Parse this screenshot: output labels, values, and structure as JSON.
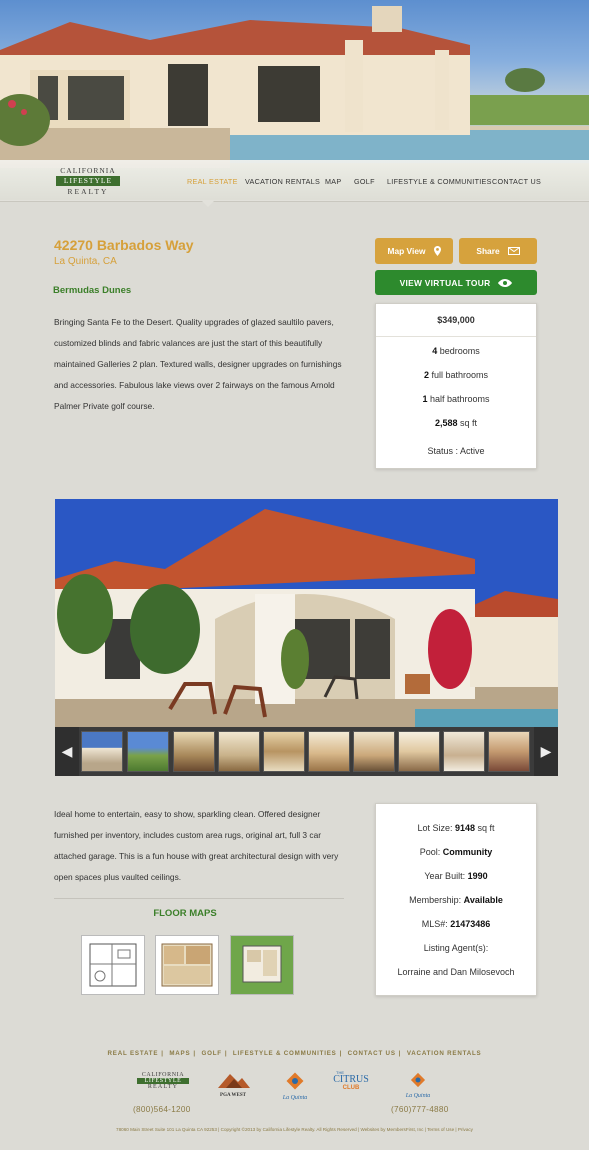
{
  "logo": {
    "line1": "CALIFORNIA",
    "line2": "LIFESTYLE",
    "line3": "REALTY"
  },
  "nav": [
    {
      "label": "REAL ESTATE",
      "active": true
    },
    {
      "label": "VACATION RENTALS",
      "active": false
    },
    {
      "label": "MAP",
      "active": false
    },
    {
      "label": "GOLF",
      "active": false
    },
    {
      "label": "LIFESTYLE & COMMUNITIES",
      "active": false
    },
    {
      "label": "CONTACT US",
      "active": false
    }
  ],
  "listing": {
    "address": "42270 Barbados Way",
    "city": "La Quinta, CA",
    "subdivision": "Bermudas Dunes",
    "description": "Bringing Santa Fe to the Desert. Quality upgrades of glazed saultilo pavers, customized blinds and fabric valances are just the start of this beautifully maintained Galleries 2 plan. Textured walls, designer upgrades on furnishings and accessories. Fabulous lake views over 2 fairways on the famous Arnold Palmer Private golf course.",
    "description2": "Ideal home to entertain, easy to show, sparkling clean. Offered designer furnished per inventory, includes custom area rugs, original art, full 3 car attached garage. This is a fun house with great architectural design with very open spaces plus vaulted ceilings."
  },
  "buttons": {
    "map_view": "Map View",
    "share": "Share",
    "virtual_tour": "VIEW VIRTUAL TOUR"
  },
  "summary": {
    "price": "$349,000",
    "bedrooms_value": "4",
    "bedrooms_label": " bedrooms",
    "full_baths_value": "2",
    "full_baths_label": " full bathrooms",
    "half_baths_value": "1",
    "half_baths_label": " half bathrooms",
    "sqft_value": "2,588",
    "sqft_label": " sq ft",
    "status": "Status : Active"
  },
  "details": {
    "lot_label": "Lot Size: ",
    "lot_value": "9148",
    "lot_unit": " sq ft",
    "pool_label": "Pool: ",
    "pool_value": "Community",
    "year_label": "Year Built: ",
    "year_value": "1990",
    "membership_label": "Membership: ",
    "membership_value": "Available",
    "mls_label": "MLS#: ",
    "mls_value": "21473486",
    "agent_label": "Listing Agent(s):",
    "agent_name": "Lorraine and Dan Milosevoch"
  },
  "floor_maps": {
    "heading": "FLOOR MAPS",
    "count": 3
  },
  "footer": {
    "links": [
      "REAL ESTATE",
      "MAPS",
      "GOLF",
      "LIFESTYLE & COMMUNITIES",
      "CONTACT US",
      "VACATION RENTALS"
    ],
    "phone_left": "(800)564-1200",
    "phone_right": "(760)777-4880",
    "partner_pga": "PGA WEST",
    "partner_laquinta": "La Quinta",
    "partner_citrus_top": "THE",
    "partner_citrus": "CITRUS",
    "partner_club": "CLUB",
    "fine_print": "78060 Main Street Suite 101 La Quinta CA 92253  |  Copyright ©2013 by California Lifestyle Realty. All Rights Reserved  |  Websites by MembersFirst, Inc  |  Terms of Use  |  Privacy"
  },
  "colors": {
    "gold": "#d6a03a",
    "green": "#2d8a2d",
    "background": "#dcdbd5"
  }
}
